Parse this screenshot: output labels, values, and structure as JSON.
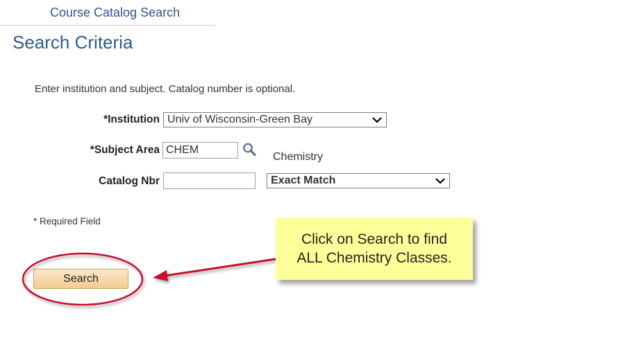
{
  "header": {
    "title": "Course Catalog Search"
  },
  "section": {
    "title": "Search Criteria"
  },
  "instructions": "Enter institution and subject.  Catalog number is optional.",
  "form": {
    "institution_label": "*Institution",
    "institution_value": "Univ of Wisconsin-Green Bay",
    "subject_label": "*Subject Area",
    "subject_value": "CHEM",
    "subject_description": "Chemistry",
    "catalog_label": "Catalog Nbr",
    "catalog_value": "",
    "match_value": "Exact Match"
  },
  "required_note": "* Required Field",
  "search_button_label": "Search",
  "callout": {
    "line1": "Click on Search to find",
    "line2": "ALL Chemistry Classes."
  },
  "colors": {
    "header_text": "#2f5597",
    "section_title": "#2d5c8a",
    "button_fill": "#f3cd8f",
    "callout_fill": "#ffff99",
    "annotation_red": "#c8102e"
  },
  "icons": {
    "lookup": "magnifier-icon",
    "dropdown": "chevron-down-icon"
  }
}
